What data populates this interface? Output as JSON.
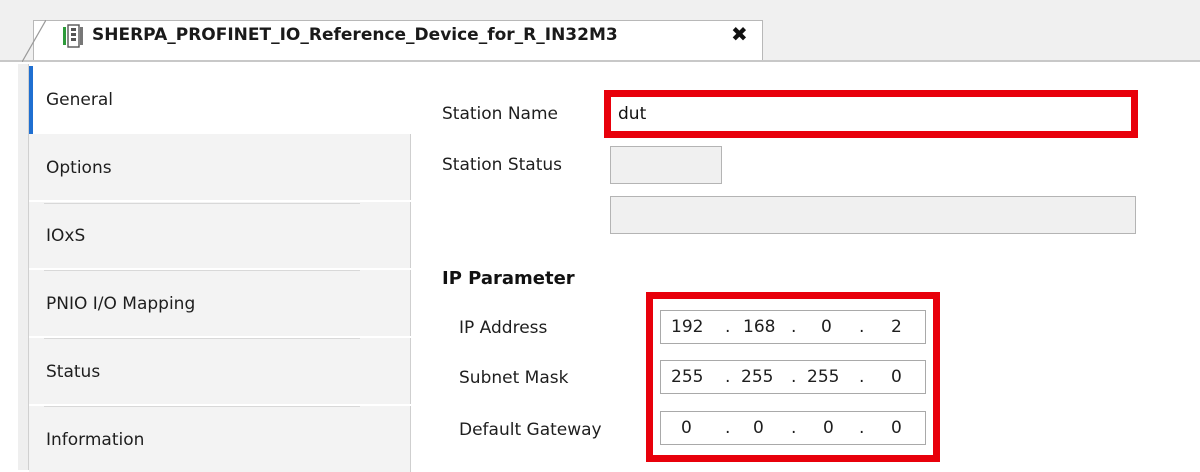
{
  "tab": {
    "title": "SHERPA_PROFINET_IO_Reference_Device_for_R_IN32M3",
    "close_glyph": "✖"
  },
  "sidebar": {
    "items": [
      {
        "label": "General",
        "active": true
      },
      {
        "label": "Options",
        "active": false
      },
      {
        "label": "IOxS",
        "active": false
      },
      {
        "label": "PNIO I/O Mapping",
        "active": false
      },
      {
        "label": "Status",
        "active": false
      },
      {
        "label": "Information",
        "active": false
      }
    ]
  },
  "general": {
    "station_name_label": "Station Name",
    "station_name_value": "dut",
    "station_status_label": "Station Status",
    "station_status_value": "",
    "station_status_text": ""
  },
  "ip_parameter": {
    "heading": "IP Parameter",
    "ip_address": {
      "label": "IP Address",
      "octets": [
        "192",
        "168",
        "0",
        "2"
      ]
    },
    "subnet_mask": {
      "label": "Subnet Mask",
      "octets": [
        "255",
        "255",
        "255",
        "0"
      ]
    },
    "default_gateway": {
      "label": "Default Gateway",
      "octets": [
        "0",
        "0",
        "0",
        "0"
      ]
    },
    "separator": "."
  },
  "colors": {
    "highlight": "#e8000b",
    "active_accent": "#1f6fd1"
  }
}
